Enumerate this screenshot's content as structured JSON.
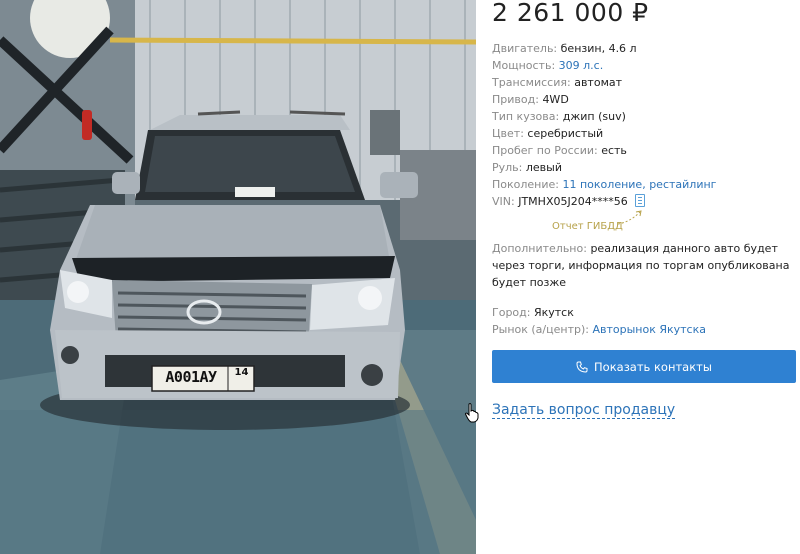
{
  "listing": {
    "price": "2 261 000 ₽",
    "specs": [
      {
        "label": "Двигатель:",
        "value": "бензин, 4.6 л"
      },
      {
        "label": "Мощность:",
        "value": "309 л.с.",
        "link": true
      },
      {
        "label": "Трансмиссия:",
        "value": "автомат"
      },
      {
        "label": "Привод:",
        "value": "4WD"
      },
      {
        "label": "Тип кузова:",
        "value": "джип (suv)"
      },
      {
        "label": "Цвет:",
        "value": "серебристый"
      },
      {
        "label": "Пробег по России:",
        "value": "есть"
      },
      {
        "label": "Руль:",
        "value": "левый"
      },
      {
        "label": "Поколение:",
        "value": "11 поколение, рестайлинг",
        "link": true
      },
      {
        "label": "VIN:",
        "value": "JTMHX05J204****56"
      }
    ],
    "gibdd_report": "Отчет ГИБДД",
    "extra_label": "Дополнительно:",
    "extra_text": "реализация данного авто будет через торги, информация по торгам опубликована будет позже",
    "city_label": "Город:",
    "city": "Якутск",
    "market_label": "Рынок (а/центр):",
    "market": "Авторынок Якутска",
    "show_contacts": "Показать контакты",
    "ask_seller": "Задать вопрос продавцу"
  },
  "photo": {
    "plate": "А001АУ",
    "plate_region": "14"
  },
  "colors": {
    "accent": "#2f81d2",
    "link": "#2c73b8",
    "label": "#8a8a8a",
    "gibdd": "#b7a24a"
  },
  "icons": [
    "phone-icon",
    "vin-doc-icon",
    "hand-cursor-icon"
  ]
}
